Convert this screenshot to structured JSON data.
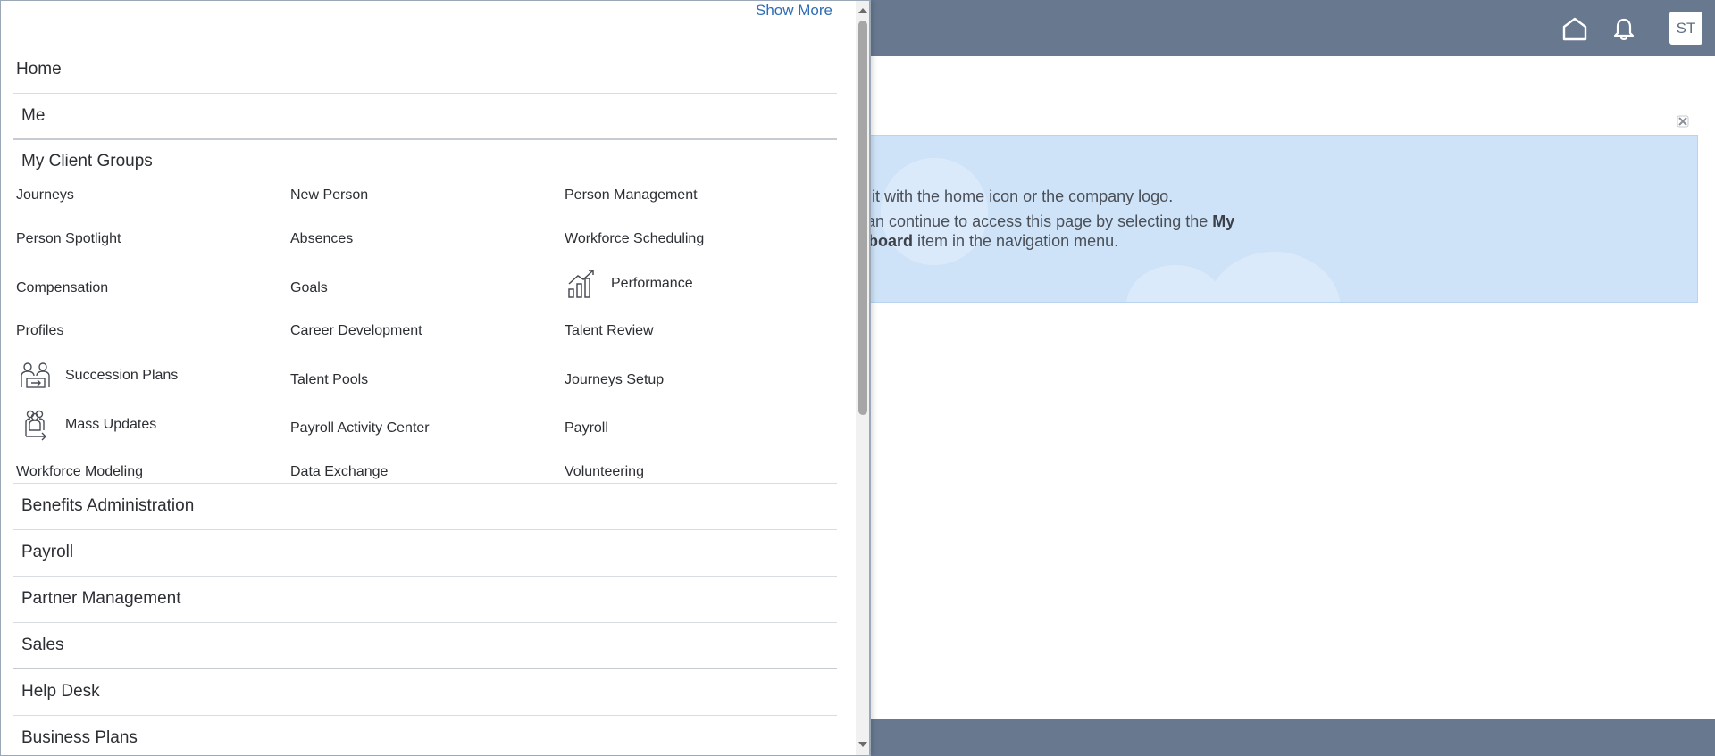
{
  "header": {
    "avatar_initials": "ST",
    "home_icon": "home-icon",
    "notifications_icon": "bell-icon"
  },
  "banner": {
    "line1": "n it with the home icon or the company logo.",
    "line2_pre": " can continue to access this page by selecting the ",
    "line2_bold": "My",
    "line3_bold": "hboard",
    "line3_post": " item in the navigation menu.",
    "close_icon": "close-icon"
  },
  "navigator": {
    "show_more": "Show More",
    "sections_top": [
      "Home",
      "Me",
      "My Client Groups"
    ],
    "items": [
      [
        "Journeys",
        "New Person",
        "Person Management"
      ],
      [
        "Person Spotlight",
        "Absences",
        "Workforce Scheduling"
      ],
      [
        "Compensation",
        "Goals",
        "Performance"
      ],
      [
        "Profiles",
        "Career Development",
        "Talent Review"
      ],
      [
        "Succession Plans",
        "Talent Pools",
        "Journeys Setup"
      ],
      [
        "Mass Updates",
        "Payroll Activity Center",
        "Payroll"
      ],
      [
        "Workforce Modeling",
        "Data Exchange",
        "Volunteering"
      ]
    ],
    "sections_bottom": [
      "Benefits Administration",
      "Payroll",
      "Partner Management",
      "Sales",
      "Help Desk",
      "Business Plans"
    ]
  },
  "colors": {
    "header_bg": "#68788f",
    "banner_bg": "#cfe3f8",
    "link": "#2f6db5"
  }
}
